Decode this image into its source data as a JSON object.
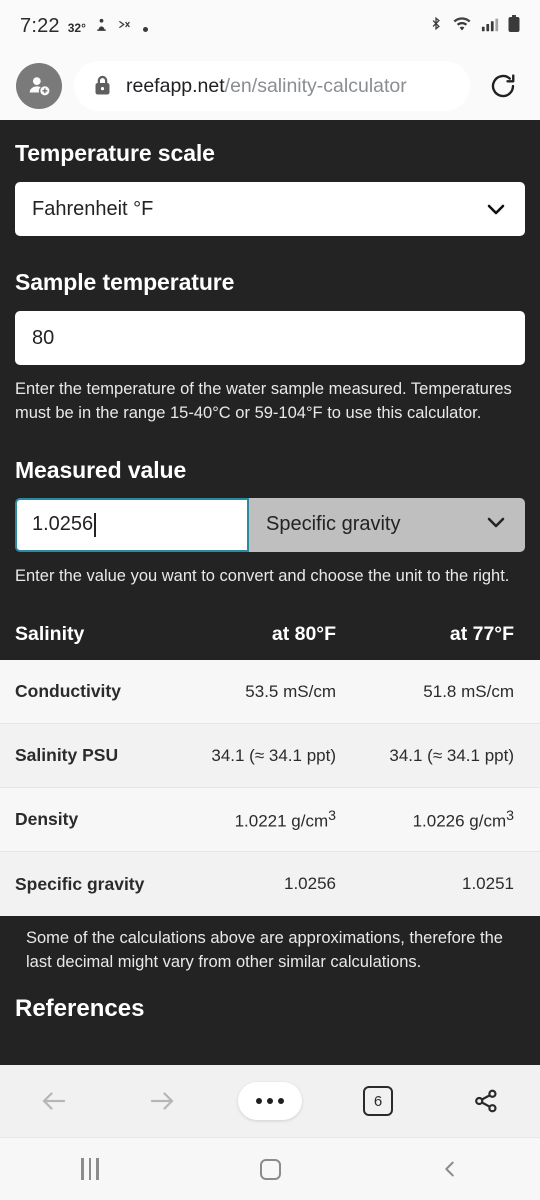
{
  "status_bar": {
    "time": "7:22",
    "temperature": "32°",
    "icons_left": [
      "do-not-disturb-icon",
      "mute-icon",
      "dot-icon"
    ],
    "icons_right": [
      "bluetooth-icon",
      "wifi-icon",
      "signal-icon",
      "battery-icon"
    ]
  },
  "browser": {
    "avatar_icon": "add-person-icon",
    "lock_icon": "lock-icon",
    "url_host": "reefapp.net",
    "url_path": "/en/salinity-calculator",
    "reload_icon": "reload-icon",
    "bottom_nav": {
      "back_icon": "back-arrow-icon",
      "forward_icon": "forward-arrow-icon",
      "menu_icon": "more-options-icon",
      "tab_count": "6",
      "share_icon": "share-icon"
    }
  },
  "system_nav": {
    "recents_icon": "recents-icon",
    "home_icon": "home-icon",
    "back_icon": "back-chevron-icon"
  },
  "page": {
    "temperature_scale": {
      "heading": "Temperature scale",
      "selected": "Fahrenheit °F",
      "chevron_icon": "chevron-down-icon"
    },
    "sample_temperature": {
      "heading": "Sample temperature",
      "value": "80",
      "help": "Enter the temperature of the water sample measured. Temperatures must be in the range 15-40°C or 59-104°F to use this calculator."
    },
    "measured_value": {
      "heading": "Measured value",
      "value": "1.0256",
      "unit": "Specific gravity",
      "chevron_icon": "chevron-down-icon",
      "help": "Enter the value you want to convert and choose the unit to the right."
    },
    "results": {
      "columns": [
        "Salinity",
        "at 80°F",
        "at 77°F"
      ],
      "rows": [
        {
          "label": "Conductivity",
          "col1": "53.5 mS/cm",
          "col2": "51.8 mS/cm"
        },
        {
          "label": "Salinity PSU",
          "col1": "34.1 (≈ 34.1 ppt)",
          "col2": "34.1 (≈ 34.1 ppt)"
        },
        {
          "label": "Density",
          "col1": "1.0221 g/cm",
          "col2": "1.0226 g/cm",
          "sup1": "3",
          "sup2": "3"
        },
        {
          "label": "Specific gravity",
          "col1": "1.0256",
          "col2": "1.0251"
        }
      ],
      "note": "Some of the calculations above are approximations, therefore the last decimal might vary from other similar calculations."
    },
    "references_heading": "References"
  },
  "colors": {
    "page_bg": "#232323",
    "focus_ring": "#2a8a9e",
    "unit_bg": "#bfbfbf",
    "chrome_bg": "#fafafa"
  }
}
